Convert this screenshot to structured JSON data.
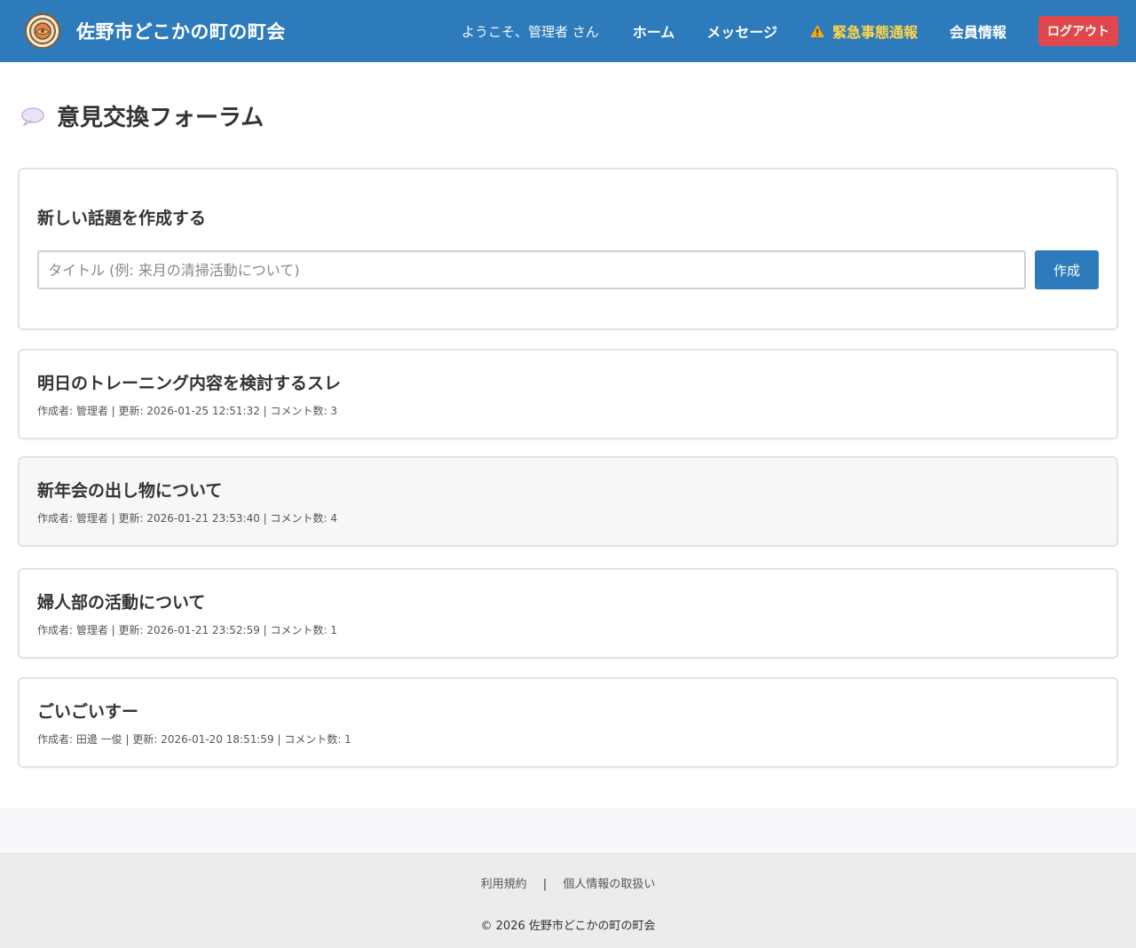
{
  "header": {
    "title": "佐野市どこかの町の町会",
    "welcome": "ようこそ、管理者 さん",
    "nav": {
      "home": "ホーム",
      "messages": "メッセージ",
      "emergency": "緊急事態通報",
      "members": "会員情報",
      "logout": "ログアウト"
    }
  },
  "page": {
    "title": "意見交換フォーラム"
  },
  "create": {
    "heading": "新しい話題を作成する",
    "placeholder": "タイトル (例: 来月の清掃活動について)",
    "button": "作成"
  },
  "topics": [
    {
      "title": "明日のトレーニング内容を検討するスレ",
      "meta": "作成者: 管理者 | 更新: 2026-01-25 12:51:32 | コメント数: 3"
    },
    {
      "title": "新年会の出し物について",
      "meta": "作成者: 管理者 | 更新: 2026-01-21 23:53:40 | コメント数: 4"
    },
    {
      "title": "婦人部の活動について",
      "meta": "作成者: 管理者 | 更新: 2026-01-21 23:52:59 | コメント数: 1"
    },
    {
      "title": "ごいごいすー",
      "meta": "作成者: 田邊 一俊 | 更新: 2026-01-20 18:51:59 | コメント数: 1"
    }
  ],
  "footer": {
    "terms": "利用規約",
    "separator": "|",
    "privacy": "個人情報の取扱い",
    "copyright": "© 2026 佐野市どこかの町の町会"
  },
  "icons": {
    "logo": "town-association-emblem",
    "emergency": "warning-icon",
    "forum": "speech-bubble-icon"
  },
  "colors": {
    "header": "#2d7bbb",
    "emergency_text": "#ffd54a",
    "logout": "#e0474c",
    "primary_button": "#2d7bbb"
  }
}
